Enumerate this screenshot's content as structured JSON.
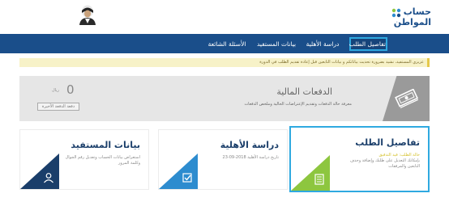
{
  "header": {
    "logo_line1": "حساب",
    "logo_line2": "المواطن",
    "avatar_icon": "king-portrait-avatar"
  },
  "nav": {
    "items": [
      {
        "label": "تفاصيل الطلب",
        "active": true
      },
      {
        "label": "دراسة الأهلية",
        "active": false
      },
      {
        "label": "بيانات المستفيد",
        "active": false
      },
      {
        "label": "الأسئلة الشائعة",
        "active": false
      }
    ]
  },
  "notice": {
    "text": "عزيزي المستفيد، نشيد بضرورة تحديث بياناتكم و بيانات التابعين قبل إعادة تقديم الطلب في الدورة"
  },
  "payments": {
    "title": "الدفعات المالية",
    "description": "معرفة حالة الدفعات وتقديم الإعتراضات الحالية وملخص الدفعات",
    "amount": "0",
    "currency": "ريال",
    "last_payment_label": "دفعة الدفعة الأخيرة",
    "icon": "money-stack-icon"
  },
  "cards": {
    "request": {
      "title": "تفاصيل الطلب",
      "status": "حالة الطلب: قيد التدقيق",
      "description": "بإمكانك التعديل على طلبك وإضافة وحذف التابعين والمرفقات",
      "icon": "document-list-icon"
    },
    "eligibility": {
      "title": "دراسة الأهلية",
      "description": "تاريخ دراسة الأهلية 2018-09-23",
      "icon": "checkbox-icon"
    },
    "beneficiary": {
      "title": "بيانات المستفيد",
      "description": "استعراض بيانات الحساب وتعديل رقم الجوال وكلمة المرور",
      "icon": "user-icon"
    }
  },
  "colors": {
    "primary": "#1a4e8a",
    "active_border": "#2fa9e0",
    "green": "#8dc63f",
    "blue": "#2d8ccf",
    "navy": "#1a3e6a"
  }
}
